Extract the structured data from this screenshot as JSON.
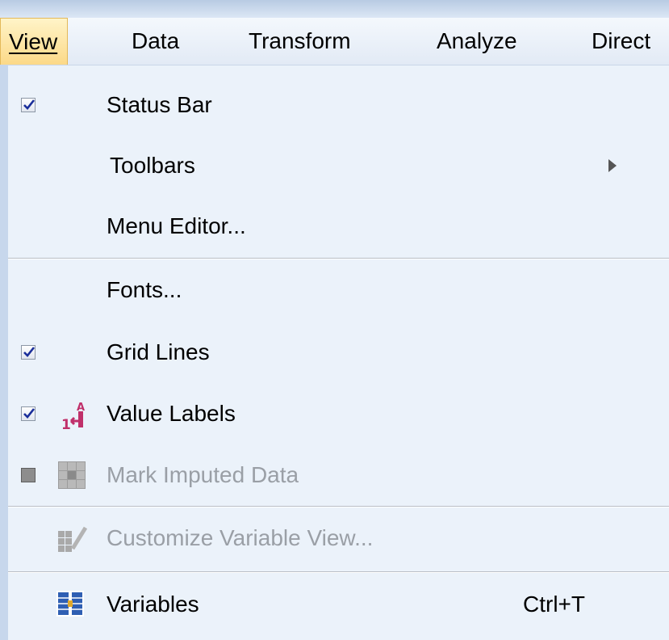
{
  "menubar": {
    "items": [
      {
        "label": "View"
      },
      {
        "label": "Data"
      },
      {
        "label": "Transform"
      },
      {
        "label": "Analyze"
      },
      {
        "label": "Direct"
      }
    ]
  },
  "menu": {
    "status_bar": {
      "label": "Status Bar",
      "checked": true
    },
    "toolbars": {
      "label": "Toolbars",
      "has_submenu": true
    },
    "menu_editor": {
      "label": "Menu Editor..."
    },
    "fonts": {
      "label": "Fonts..."
    },
    "grid_lines": {
      "label": "Grid Lines",
      "checked": true
    },
    "value_labels": {
      "label": "Value Labels",
      "checked": true,
      "icon": "value-labels-icon"
    },
    "mark_imputed": {
      "label": "Mark Imputed Data",
      "enabled": false,
      "icon": "grid-icon"
    },
    "customize_var_view": {
      "label": "Customize Variable View...",
      "enabled": false,
      "icon": "customize-icon"
    },
    "variables": {
      "label": "Variables",
      "shortcut": "Ctrl+T",
      "icon": "variables-icon"
    }
  },
  "colors": {
    "menu_background": "#ebf2fa",
    "active_menu_highlight": "#fcd988",
    "disabled_text": "#9a9fa6",
    "value_labels_icon": "#c0306a"
  }
}
